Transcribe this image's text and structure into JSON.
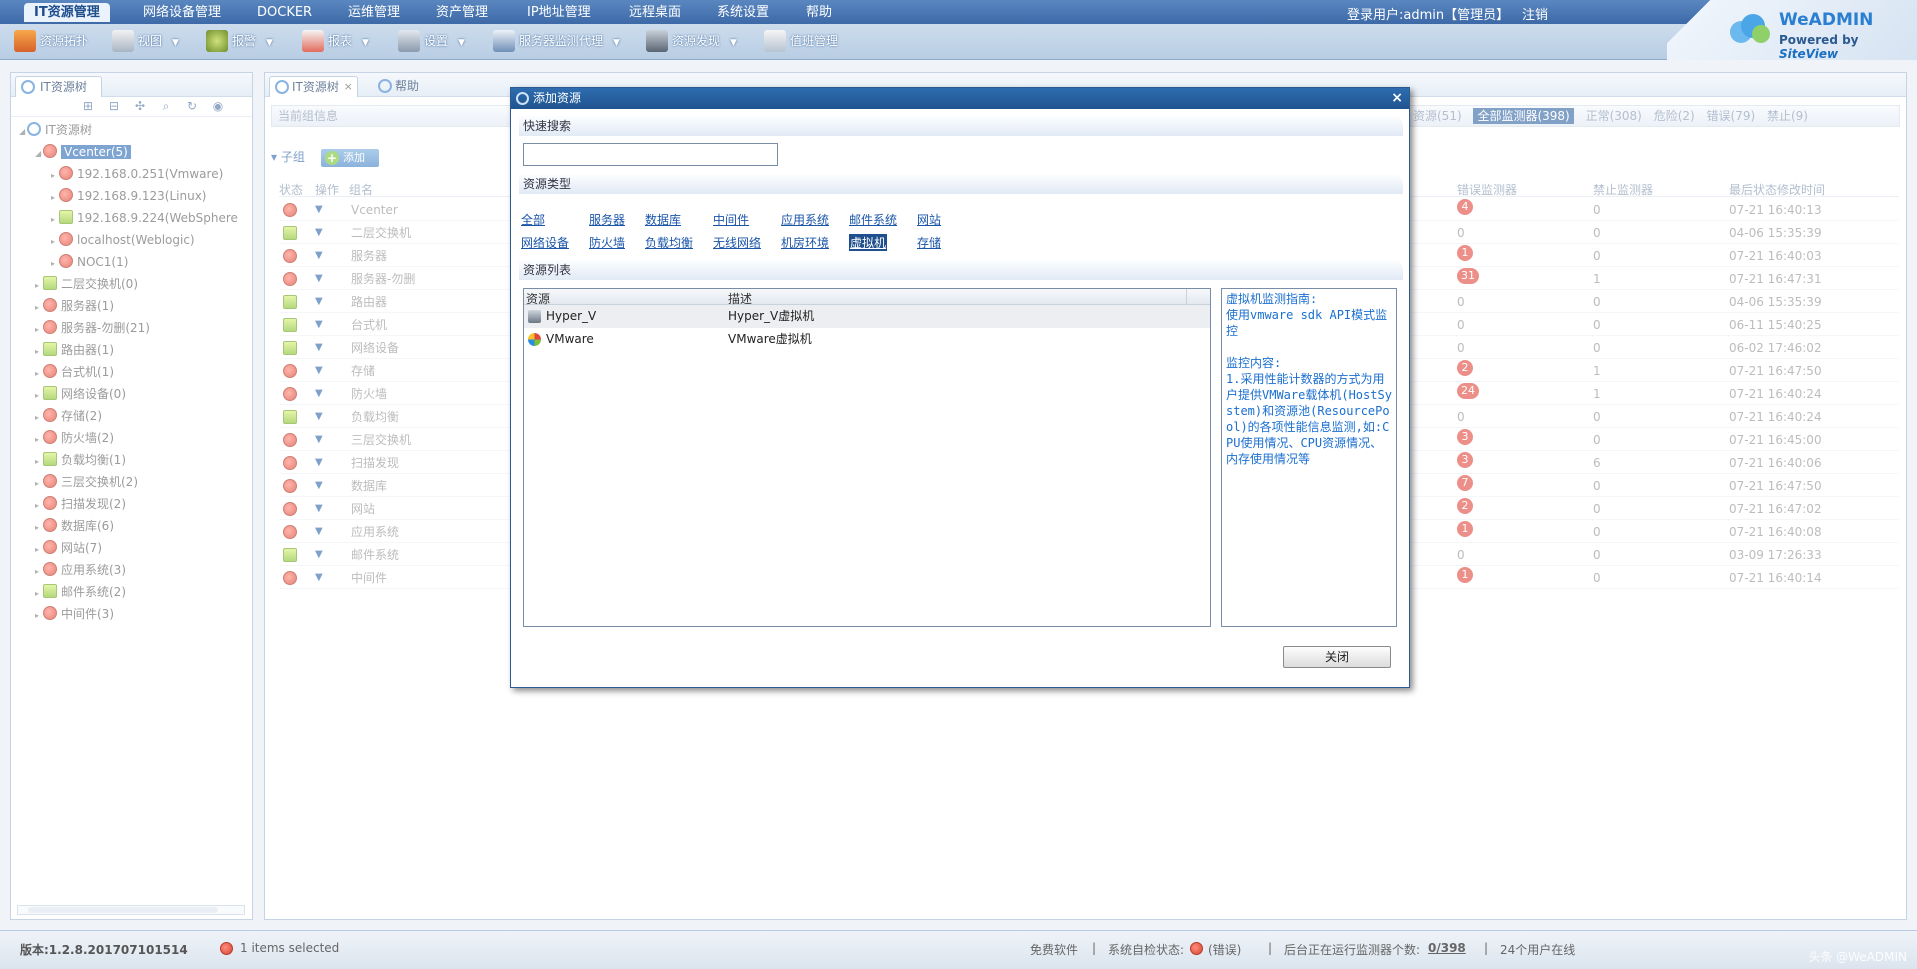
{
  "menubar": {
    "items": [
      "IT资源管理",
      "网络设备管理",
      "DOCKER",
      "运维管理",
      "资产管理",
      "IP地址管理",
      "远程桌面",
      "系统设置",
      "帮助"
    ],
    "login": "登录用户:admin【管理员】",
    "logout": "注销"
  },
  "logo": {
    "title": "WeADMIN",
    "powered": "Powered by",
    "brand": "SiteView"
  },
  "toolbar": {
    "items": [
      "资源拓扑",
      "视图",
      "报警",
      "报表",
      "设置",
      "服务器监测代理",
      "资源发现",
      "值班管理"
    ]
  },
  "left_panel": {
    "tab": "IT资源树",
    "tree": [
      {
        "label": "IT资源树",
        "level": 0,
        "icon": "tree-root-icon"
      },
      {
        "label": "Vcenter(5)",
        "level": 1,
        "icon": "folder-error-icon",
        "selected": true
      },
      {
        "label": "192.168.0.251(Vmware)",
        "level": 2,
        "icon": "server-error-icon"
      },
      {
        "label": "192.168.9.123(Linux)",
        "level": 2,
        "icon": "server-error-icon"
      },
      {
        "label": "192.168.9.224(WebSphere",
        "level": 2,
        "icon": "server-ok-icon"
      },
      {
        "label": "localhost(Weblogic)",
        "level": 2,
        "icon": "server-error-icon"
      },
      {
        "label": "NOC1(1)",
        "level": 2,
        "icon": "folder-error-icon"
      },
      {
        "label": "二层交换机(0)",
        "level": 1,
        "icon": "folder-ok-icon"
      },
      {
        "label": "服务器(1)",
        "level": 1,
        "icon": "folder-error-icon"
      },
      {
        "label": "服务器-勿删(21)",
        "level": 1,
        "icon": "folder-error-icon"
      },
      {
        "label": "路由器(1)",
        "level": 1,
        "icon": "folder-ok-icon"
      },
      {
        "label": "台式机(1)",
        "level": 1,
        "icon": "folder-error-icon"
      },
      {
        "label": "网络设备(0)",
        "level": 1,
        "icon": "folder-ok-icon"
      },
      {
        "label": "存储(2)",
        "level": 1,
        "icon": "folder-error-icon"
      },
      {
        "label": "防火墙(2)",
        "level": 1,
        "icon": "folder-error-icon"
      },
      {
        "label": "负载均衡(1)",
        "level": 1,
        "icon": "folder-ok-icon"
      },
      {
        "label": "三层交换机(2)",
        "level": 1,
        "icon": "folder-error-icon"
      },
      {
        "label": "扫描发现(2)",
        "level": 1,
        "icon": "folder-error-icon"
      },
      {
        "label": "数据库(6)",
        "level": 1,
        "icon": "folder-error-icon"
      },
      {
        "label": "网站(7)",
        "level": 1,
        "icon": "folder-error-icon"
      },
      {
        "label": "应用系统(3)",
        "level": 1,
        "icon": "folder-error-icon"
      },
      {
        "label": "邮件系统(2)",
        "level": 1,
        "icon": "folder-ok-icon"
      },
      {
        "label": "中间件(3)",
        "level": 1,
        "icon": "folder-error-icon"
      }
    ]
  },
  "main_panel": {
    "tabs": [
      "IT资源树",
      "帮助"
    ],
    "group_info": "当前组信息",
    "stats": {
      "resources": "资源(51)",
      "all_monitors": "全部监测器(398)",
      "normal": "正常(308)",
      "danger": "危险(2)",
      "error": "错误(79)",
      "disabled": "禁止(9)"
    },
    "subgroup_label": "子组",
    "add_label": "添加",
    "columns": [
      "状态",
      "操作",
      "组名",
      "错误监测器",
      "禁止监测器",
      "最后状态修改时间"
    ],
    "rows": [
      {
        "status": "error",
        "name": "Vcenter",
        "errors": "4",
        "disabled": "0",
        "time": "07-21 16:40:13"
      },
      {
        "status": "ok",
        "name": "二层交换机",
        "errors": "0",
        "disabled": "0",
        "time": "04-06 15:35:39"
      },
      {
        "status": "error",
        "name": "服务器",
        "errors": "1",
        "disabled": "0",
        "time": "07-21 16:40:03"
      },
      {
        "status": "error",
        "name": "服务器-勿删",
        "errors": "31",
        "disabled": "1",
        "time": "07-21 16:47:31"
      },
      {
        "status": "ok",
        "name": "路由器",
        "errors": "0",
        "disabled": "0",
        "time": "04-06 15:35:39"
      },
      {
        "status": "ok",
        "name": "台式机",
        "errors": "0",
        "disabled": "0",
        "time": "06-11 15:40:25"
      },
      {
        "status": "ok",
        "name": "网络设备",
        "errors": "0",
        "disabled": "0",
        "time": "06-02 17:46:02"
      },
      {
        "status": "error",
        "name": "存储",
        "errors": "2",
        "disabled": "1",
        "time": "07-21 16:47:50"
      },
      {
        "status": "error",
        "name": "防火墙",
        "errors": "24",
        "disabled": "1",
        "time": "07-21 16:40:24"
      },
      {
        "status": "ok",
        "name": "负载均衡",
        "errors": "0",
        "disabled": "0",
        "time": "07-21 16:40:24"
      },
      {
        "status": "error",
        "name": "三层交换机",
        "errors": "3",
        "disabled": "0",
        "time": "07-21 16:45:00"
      },
      {
        "status": "error",
        "name": "扫描发现",
        "errors": "3",
        "disabled": "6",
        "time": "07-21 16:40:06"
      },
      {
        "status": "error",
        "name": "数据库",
        "errors": "7",
        "disabled": "0",
        "time": "07-21 16:47:50"
      },
      {
        "status": "error",
        "name": "网站",
        "errors": "2",
        "disabled": "0",
        "time": "07-21 16:47:02"
      },
      {
        "status": "error",
        "name": "应用系统",
        "errors": "1",
        "disabled": "0",
        "time": "07-21 16:40:08"
      },
      {
        "status": "ok",
        "name": "邮件系统",
        "errors": "0",
        "disabled": "0",
        "time": "03-09 17:26:33"
      },
      {
        "status": "error",
        "name": "中间件",
        "errors": "1",
        "disabled": "0",
        "time": "07-21 16:40:14"
      }
    ]
  },
  "modal": {
    "title": "添加资源",
    "close_x": "×",
    "quick_search_label": "快速搜索",
    "search_value": "",
    "resource_type_label": "资源类型",
    "types_row1": [
      "全部",
      "服务器",
      "数据库",
      "中间件",
      "应用系统",
      "邮件系统",
      "网站"
    ],
    "types_row2": [
      "网络设备",
      "防火墙",
      "负载均衡",
      "无线网络",
      "机房环境",
      "虚拟机",
      "存储"
    ],
    "selected_type": "虚拟机",
    "resource_list_label": "资源列表",
    "list_columns": [
      "资源",
      "描述"
    ],
    "list_rows": [
      {
        "name": "Hyper_V",
        "desc": "Hyper_V虚拟机",
        "icon": "hyperv-icon"
      },
      {
        "name": "VMware",
        "desc": "VMware虚拟机",
        "icon": "vmware-icon"
      }
    ],
    "description": "虚拟机监测指南:\n使用vmware sdk API模式监控\n\n监控内容:\n1.采用性能计数器的方式为用户提供VMWare载体机(HostSystem)和资源池(ResourcePool)的各项性能信息监测,如:CPU使用情况、CPU资源情况、内存使用情况等",
    "close_button": "关闭"
  },
  "statusbar": {
    "version": "版本:1.2.8.201707101514",
    "selection": "1 items selected",
    "free": "免费软件",
    "sep": "|",
    "self_check": "系统自检状态:",
    "self_check_status": "(错误)",
    "monitor_count_label": "后台正在运行监测器个数:",
    "monitor_count": "0/398",
    "online": "24个用户在线",
    "watermark": "头条 @WeADMIN"
  },
  "colors": {
    "accent": "#3d6aa8",
    "error": "#e2534b",
    "ok": "#8cc53a",
    "link": "#1a55a8"
  }
}
